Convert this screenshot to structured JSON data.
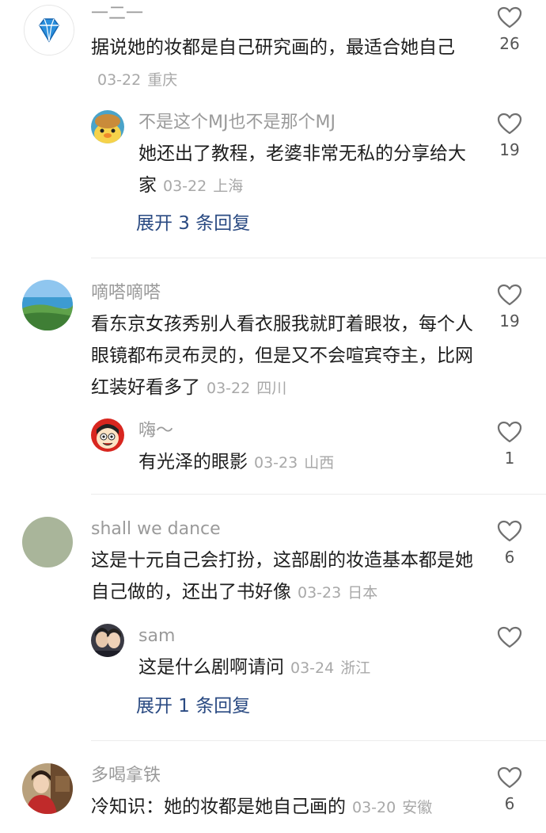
{
  "comments": [
    {
      "user": "一二一",
      "text": "据说她的妆都是自己研究画的，最适合她自己",
      "date": "03-22",
      "location": "重庆",
      "likes": "26",
      "avatar_icon": "diamond-icon",
      "reply": {
        "user": "不是这个MJ也不是那个MJ",
        "text": "她还出了教程，老婆非常无私的分享给大家",
        "date": "03-22",
        "location": "上海",
        "likes": "19",
        "avatar_icon": "duck-icon"
      },
      "expand_label": "展开 3 条回复"
    },
    {
      "user": "嘀嗒嘀嗒",
      "text": "看东京女孩秀别人看衣服我就盯着眼妆，每个人眼镜都布灵布灵的，但是又不会喧宾夺主，比网红装好看多了",
      "date": "03-22",
      "location": "四川",
      "likes": "19",
      "avatar_icon": "landscape-icon",
      "reply": {
        "user": "嗨～",
        "text": "有光泽的眼影",
        "date": "03-23",
        "location": "山西",
        "likes": "1",
        "avatar_icon": "cartoon-face-icon"
      }
    },
    {
      "user": "shall we dance",
      "text": "这是十元自己会打扮，这部剧的妆造基本都是她自己做的，还出了书好像",
      "date": "03-23",
      "location": "日本",
      "likes": "6",
      "avatar_icon": "plain-avatar-icon",
      "reply": {
        "user": "sam",
        "text": "这是什么剧啊请问",
        "date": "03-24",
        "location": "浙江",
        "likes": "",
        "avatar_icon": "couple-photo-icon"
      },
      "expand_label": "展开 1 条回复"
    },
    {
      "user": "多喝拿铁",
      "text": "冷知识：她的妆都是她自己画的",
      "date": "03-20",
      "location": "安徽",
      "likes": "6",
      "avatar_icon": "photo-avatar-icon"
    }
  ],
  "colors": {
    "link": "#2a4a82",
    "meta": "#a8a8a8",
    "username": "#9a9a9a"
  }
}
